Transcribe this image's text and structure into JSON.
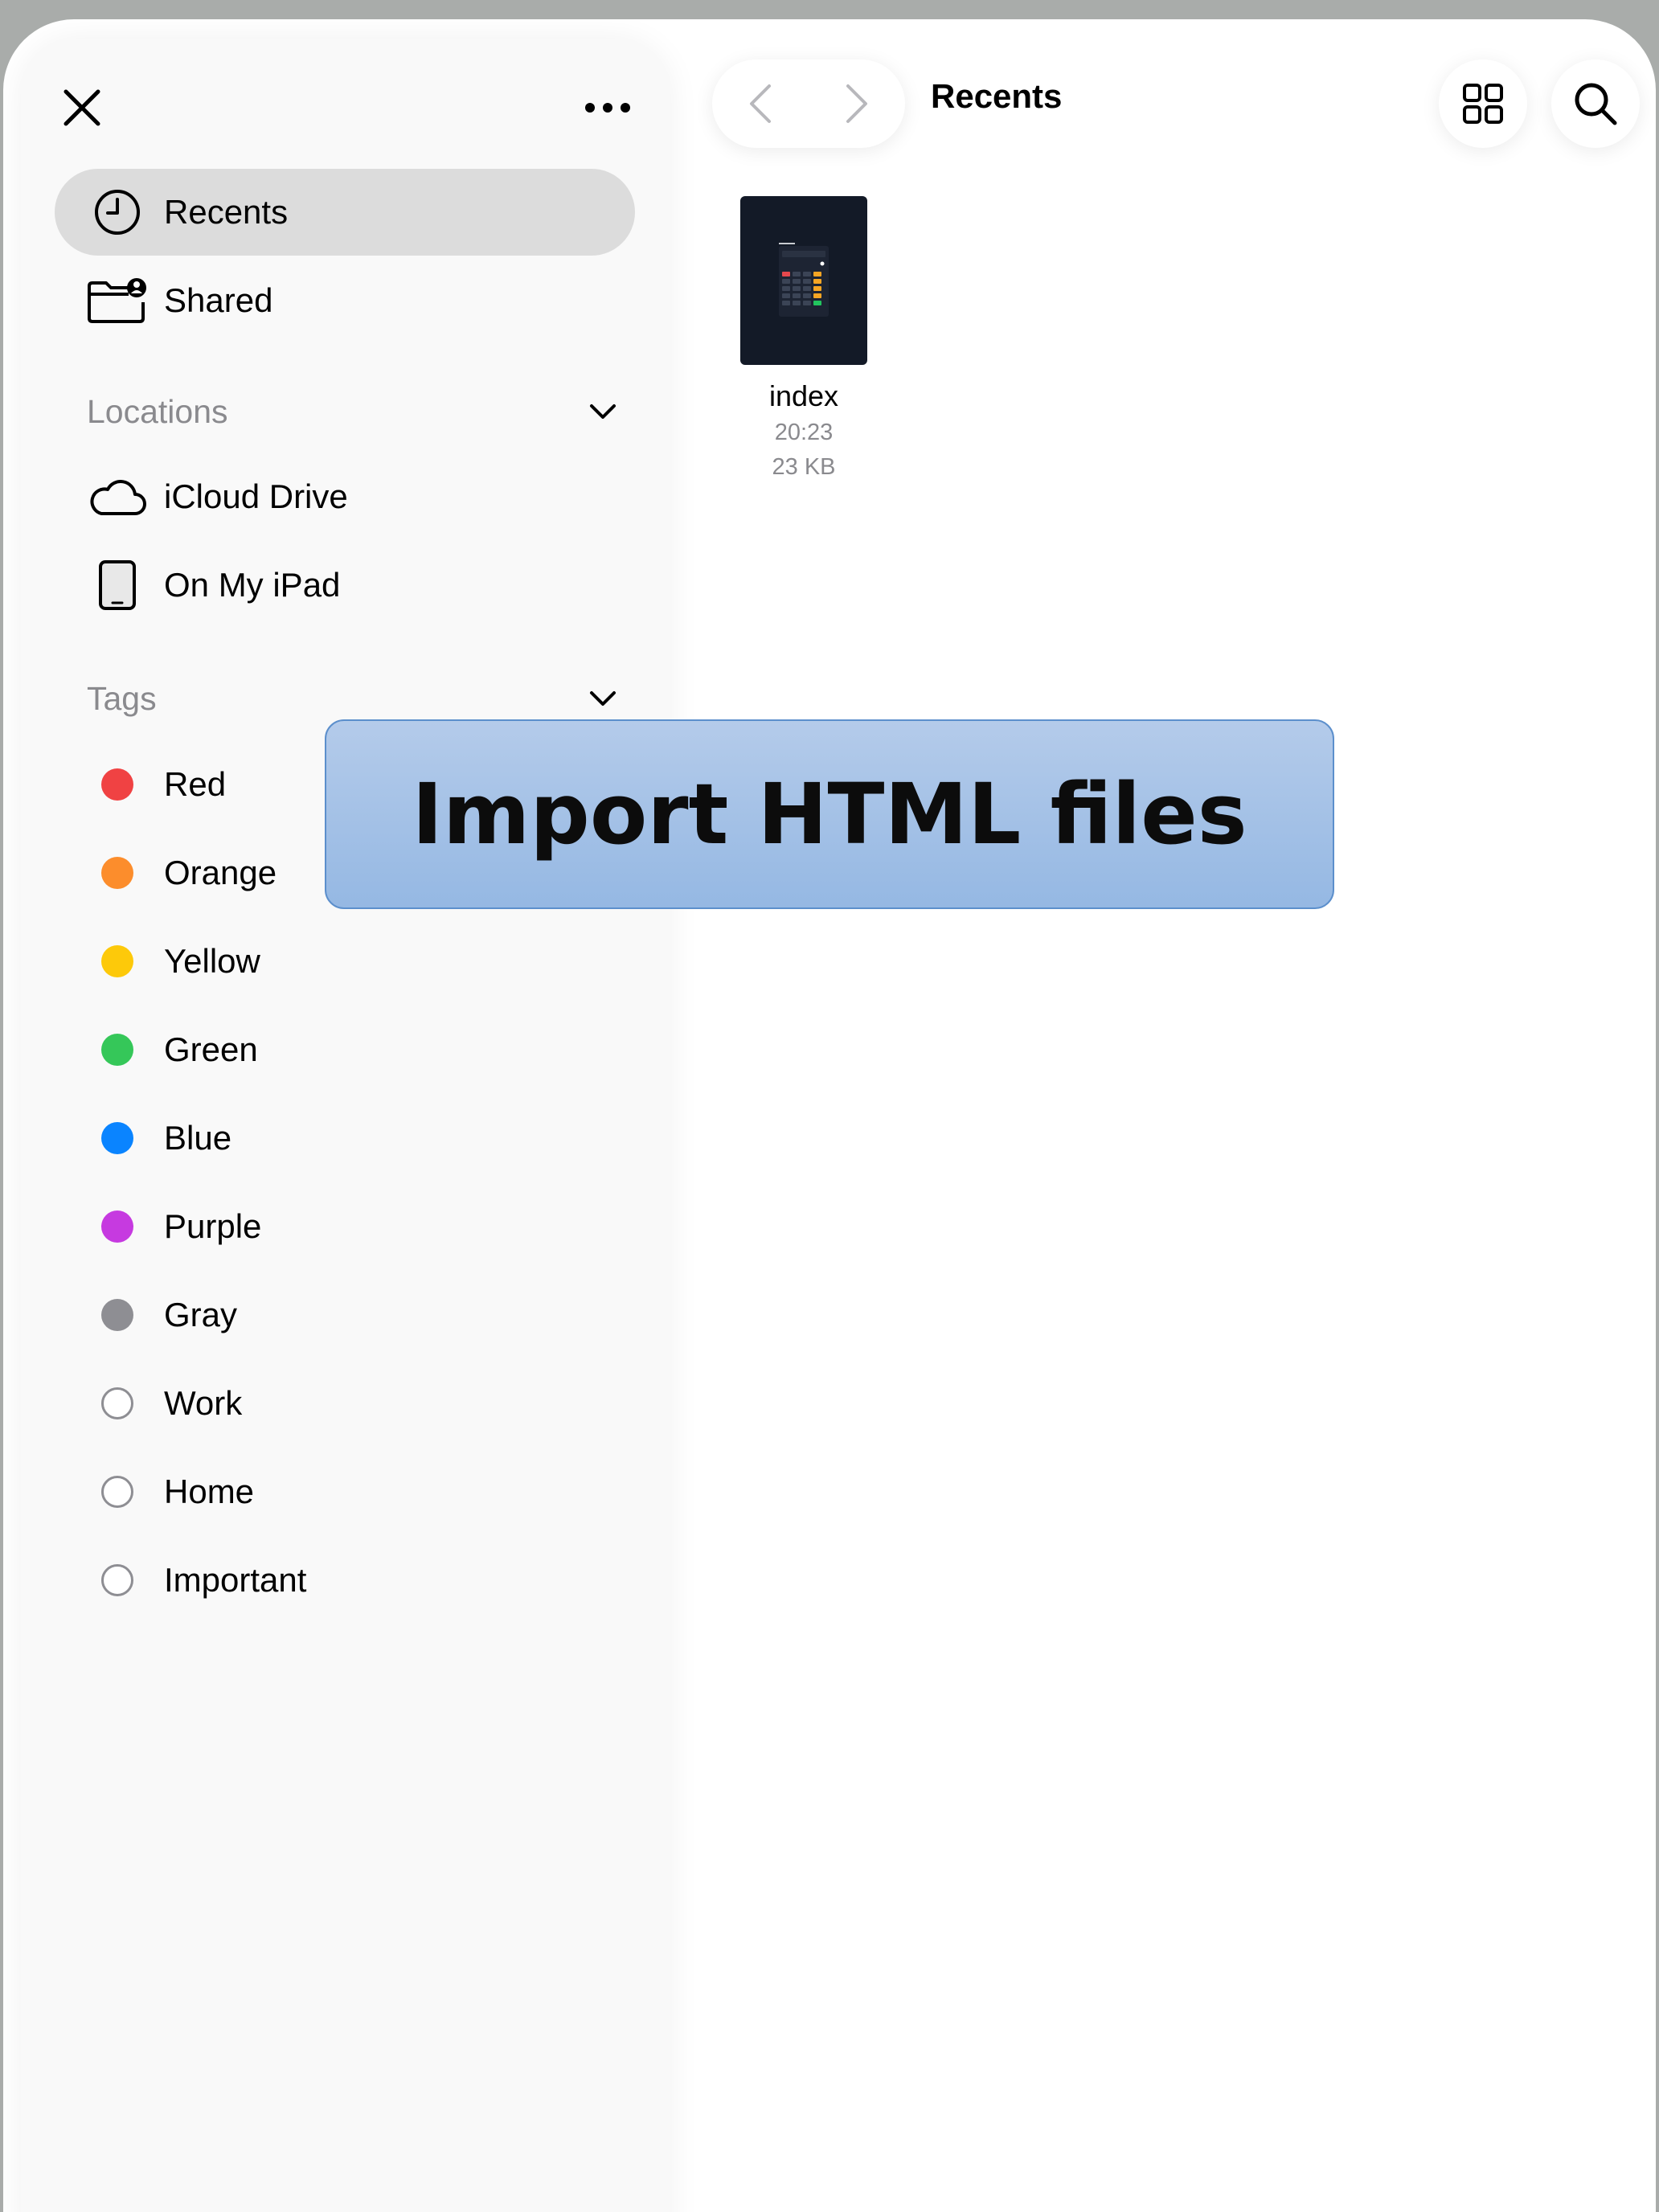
{
  "sidebar": {
    "favorites": [
      {
        "label": "Recents",
        "icon": "clock-icon",
        "selected": true
      },
      {
        "label": "Shared",
        "icon": "shared-folder-icon",
        "selected": false
      }
    ],
    "locations": {
      "title": "Locations",
      "items": [
        {
          "label": "iCloud Drive",
          "icon": "cloud-icon"
        },
        {
          "label": "On My iPad",
          "icon": "ipad-icon"
        }
      ]
    },
    "tags": {
      "title": "Tags",
      "items": [
        {
          "label": "Red",
          "color": "#f04243"
        },
        {
          "label": "Orange",
          "color": "#fc8d2c"
        },
        {
          "label": "Yellow",
          "color": "#fdc90a"
        },
        {
          "label": "Green",
          "color": "#35c759"
        },
        {
          "label": "Blue",
          "color": "#0a84ff"
        },
        {
          "label": "Purple",
          "color": "#c63ae0"
        },
        {
          "label": "Gray",
          "color": "#8e8e93"
        },
        {
          "label": "Work",
          "color": ""
        },
        {
          "label": "Home",
          "color": ""
        },
        {
          "label": "Important",
          "color": ""
        }
      ]
    }
  },
  "main": {
    "title": "Recents",
    "files": [
      {
        "name": "index",
        "time": "20:23",
        "size": "23 KB"
      }
    ]
  },
  "banner": {
    "text": "Import HTML files"
  }
}
